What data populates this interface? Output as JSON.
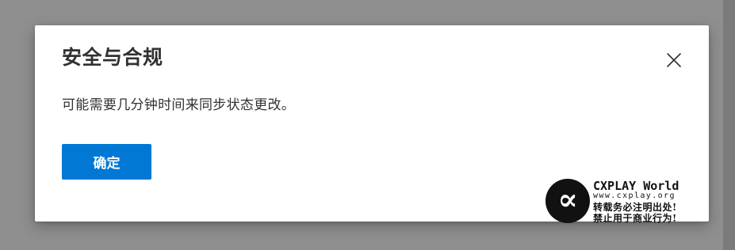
{
  "dialog": {
    "title": "安全与合规",
    "message": "可能需要几分钟时间来同步状态更改。",
    "ok_label": "确定",
    "close_icon": "close-icon"
  },
  "watermark": {
    "logo_icon": "cxplay-logo-icon",
    "logo_glyph": "∝",
    "title": "CXPLAY World",
    "url": "www.cxplay.org",
    "notice_line1": "转载务必注明出处!",
    "notice_line2": "禁止用于商业行为!"
  },
  "colors": {
    "backdrop": "#8f8f8f",
    "dialog_bg": "#ffffff",
    "primary": "#0078d4",
    "text": "#323130"
  }
}
